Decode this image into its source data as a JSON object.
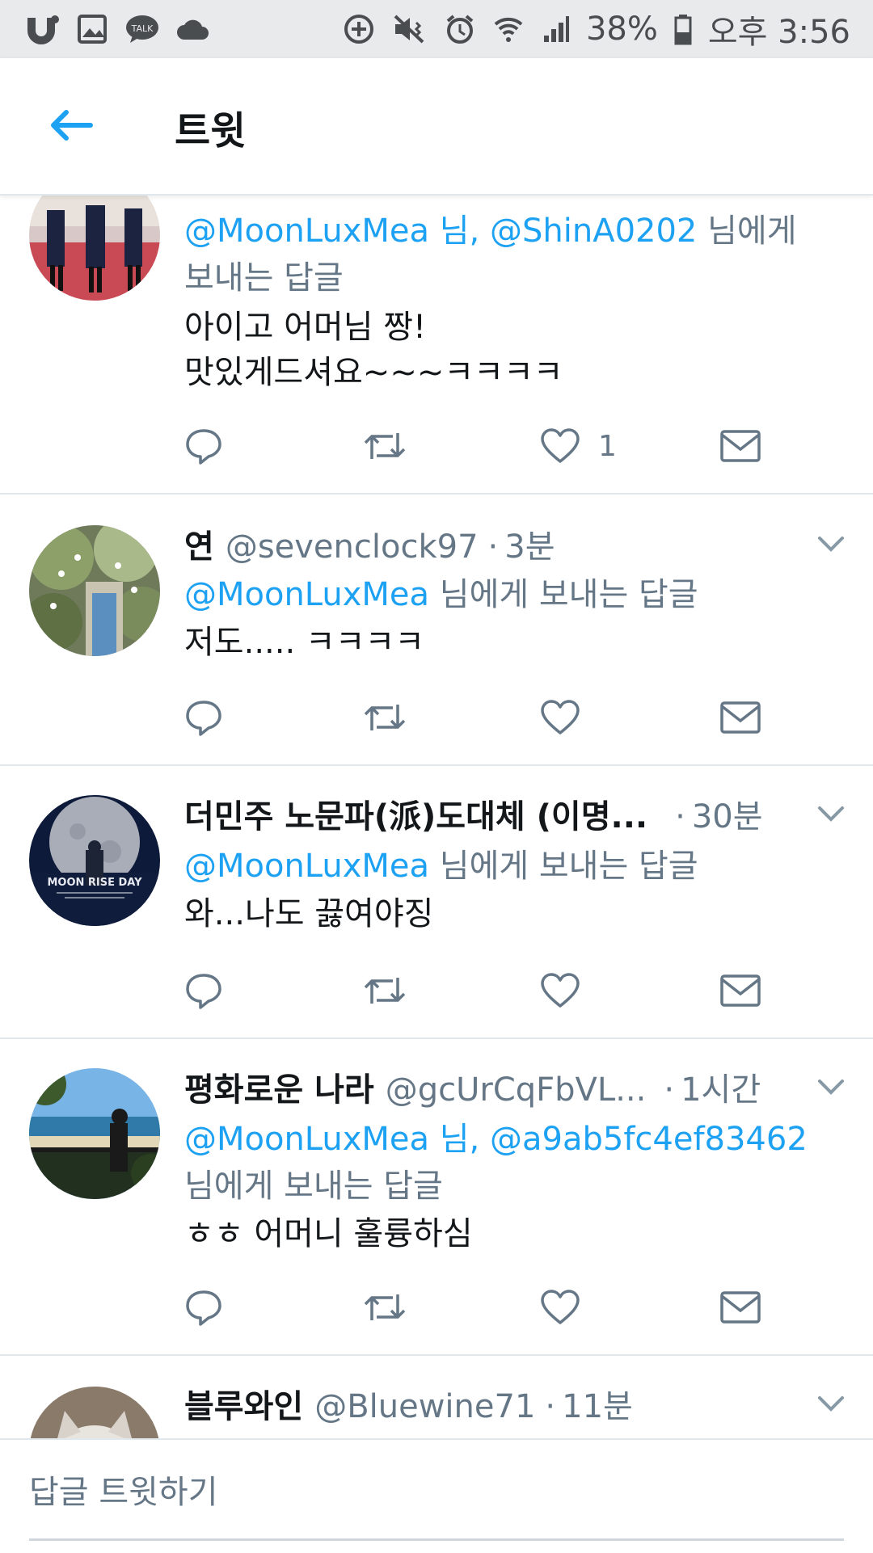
{
  "status_bar": {
    "battery": "38%",
    "time": "오후 3:56",
    "left_icons": [
      "u-plus-icon",
      "gallery-icon",
      "kakaotalk-icon",
      "cloud-icon"
    ],
    "right_icons": [
      "data-saver-icon",
      "mute-vibrate-icon",
      "alarm-icon",
      "wifi-icon",
      "signal-icon",
      "battery-icon"
    ]
  },
  "header": {
    "title": "트윗",
    "back_icon": "arrow-left-icon"
  },
  "tweets": [
    {
      "reply_mentions": [
        "@MoonLuxMea 님,",
        "@ShinA0202"
      ],
      "reply_suffix": "님에게",
      "reply_line2": "보내는 답글",
      "text_lines": [
        "아이고 어머님 짱!",
        "맛있게드셔요~~~ㅋㅋㅋㅋ"
      ],
      "like_count": "1"
    },
    {
      "name": "연",
      "handle": "@sevenclock97",
      "time": "3분",
      "reply_mentions": [
        "@MoonLuxMea"
      ],
      "reply_suffix": "님에게 보내는 답글",
      "text_lines": [
        "저도..... ㅋㅋㅋㅋ"
      ]
    },
    {
      "name": "더민주 노문파(派)도대체 (이명...",
      "handle": "",
      "time": "30분",
      "avatar_text": "MOON RISE DAY",
      "reply_mentions": [
        "@MoonLuxMea"
      ],
      "reply_suffix": "님에게 보내는 답글",
      "text_lines": [
        "와...나도 끓여야징"
      ]
    },
    {
      "name": "평화로운 나라",
      "handle": "@gcUrCqFbVL...",
      "time": "1시간",
      "reply_mentions": [
        "@MoonLuxMea 님,",
        "@a9ab5fc4ef83462"
      ],
      "reply_line2": "님에게 보내는 답글",
      "text_lines": [
        "ㅎㅎ 어머니 훌륭하심"
      ]
    },
    {
      "name": "블루와인",
      "handle": "@Bluewine71",
      "time": "11분"
    }
  ],
  "composer": {
    "placeholder": "답글 트윗하기"
  },
  "colors": {
    "accent": "#1da1f2",
    "text": "#14171a",
    "secondary": "#657786",
    "divider": "#e1e8ed"
  }
}
